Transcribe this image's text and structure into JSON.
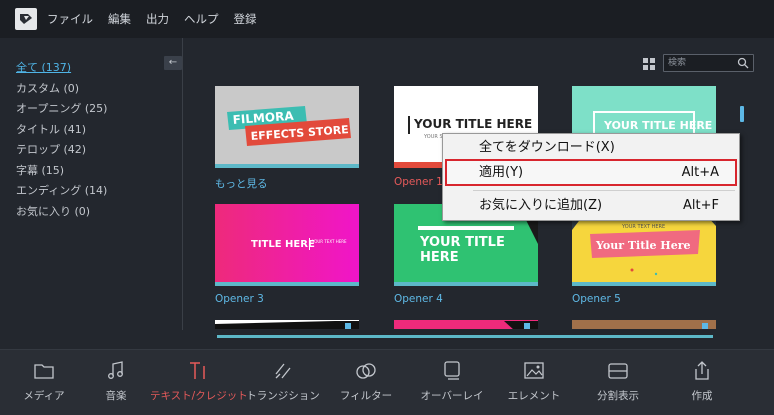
{
  "menu": {
    "items": [
      "ファイル",
      "編集",
      "出力",
      "ヘルプ",
      "登録"
    ]
  },
  "sidebar": {
    "categories": [
      {
        "label": "全て (137)",
        "active": true
      },
      {
        "label": "カスタム (0)"
      },
      {
        "label": "オープニング (25)"
      },
      {
        "label": "タイトル (41)"
      },
      {
        "label": "テロップ (42)"
      },
      {
        "label": "字幕 (15)"
      },
      {
        "label": "エンディング (14)"
      },
      {
        "label": "お気に入り (0)"
      }
    ],
    "collapse_glyph": "←"
  },
  "search": {
    "placeholder": "検索"
  },
  "thumbnails": [
    {
      "label": "もっと見る",
      "text1": "FILMORA",
      "text2": "EFFECTS STORE"
    },
    {
      "label": "Opener 1",
      "text1": "YOUR TITLE HERE",
      "text2": "YOUR SUBTITLE HERE"
    },
    {
      "label": "",
      "text1": "YOUR TITLE HERE"
    },
    {
      "label": "Opener 3",
      "text1": "TITLE HERE",
      "text2": "YOUR TEXT HERE"
    },
    {
      "label": "Opener 4",
      "text1": "YOUR TITLE",
      "text2": "HERE"
    },
    {
      "label": "Opener 5",
      "text1": "YOUR TEXT HERE",
      "text2": "Your Title Here"
    }
  ],
  "context_menu": {
    "items": [
      {
        "label": "全てをダウンロード(X)",
        "shortcut": ""
      },
      {
        "label": "適用(Y)",
        "shortcut": "Alt+A"
      },
      {
        "label": "お気に入りに追加(Z)",
        "shortcut": "Alt+F"
      }
    ]
  },
  "toolbar": {
    "items": [
      {
        "label": "メディア",
        "icon": "folder-icon"
      },
      {
        "label": "音楽",
        "icon": "music-note-icon"
      },
      {
        "label": "テキスト/クレジット",
        "icon": "text-icon",
        "active": true
      },
      {
        "label": "トランジション",
        "icon": "transition-icon"
      },
      {
        "label": "フィルター",
        "icon": "filter-icon"
      },
      {
        "label": "オーバーレイ",
        "icon": "overlay-icon"
      },
      {
        "label": "エレメント",
        "icon": "element-icon"
      },
      {
        "label": "分割表示",
        "icon": "split-screen-icon"
      },
      {
        "label": "作成",
        "icon": "export-icon"
      }
    ]
  },
  "colors": {
    "accent": "#4fb4e6",
    "active_tool": "#e65a5a",
    "highlight_border": "#d8262e"
  }
}
